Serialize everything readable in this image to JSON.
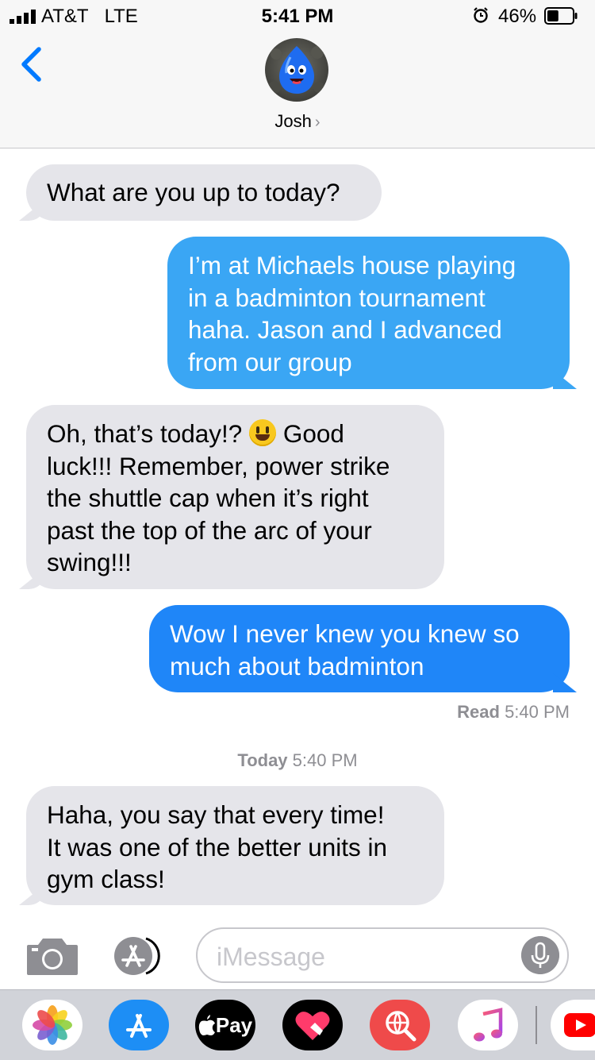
{
  "status_bar": {
    "carrier": "AT&T",
    "network": "LTE",
    "time": "5:41 PM",
    "battery": "46%",
    "battery_level": 0.46
  },
  "header": {
    "contact_name": "Josh",
    "chevron": "›"
  },
  "messages": [
    {
      "direction": "incoming",
      "text": "What are you up to today?"
    },
    {
      "direction": "outgoing",
      "type": "imessage",
      "lines": [
        "I’m at Michaels house playing",
        "in a badminton tournament",
        "haha. Jason and I advanced",
        "from our group"
      ]
    },
    {
      "direction": "incoming",
      "lines_before_emoji": "Oh, that’s today!? ",
      "emoji": "grinning-face",
      "lines_after_emoji": " Good",
      "lines": [
        "luck!!! Remember, power strike",
        "the shuttle cap when it’s right",
        "past the top of the arc of your",
        "swing!!!"
      ]
    },
    {
      "direction": "outgoing",
      "type": "imessage",
      "lines": [
        "Wow I never knew you knew so",
        "much about badminton"
      ]
    },
    {
      "direction": "incoming",
      "lines": [
        "Haha, you say that every time!",
        "It was one of the better units in",
        "gym class!"
      ]
    }
  ],
  "read_receipt": {
    "label": "Read",
    "time": "5:40 PM"
  },
  "timestamp": {
    "label": "Today",
    "time": "5:40 PM"
  },
  "input": {
    "placeholder": "iMessage"
  },
  "app_drawer": {
    "apps": [
      "photos-icon",
      "app-store-icon",
      "apple-pay-icon",
      "digital-touch-icon",
      "web-images-icon",
      "music-icon",
      "youtube-icon"
    ],
    "apple_pay_label": "Pay"
  },
  "colors": {
    "incoming_bubble": "#e5e5ea",
    "outgoing_light": "#3aa6f4",
    "outgoing_dark": "#1f86f8",
    "ios_blue": "#007aff"
  }
}
